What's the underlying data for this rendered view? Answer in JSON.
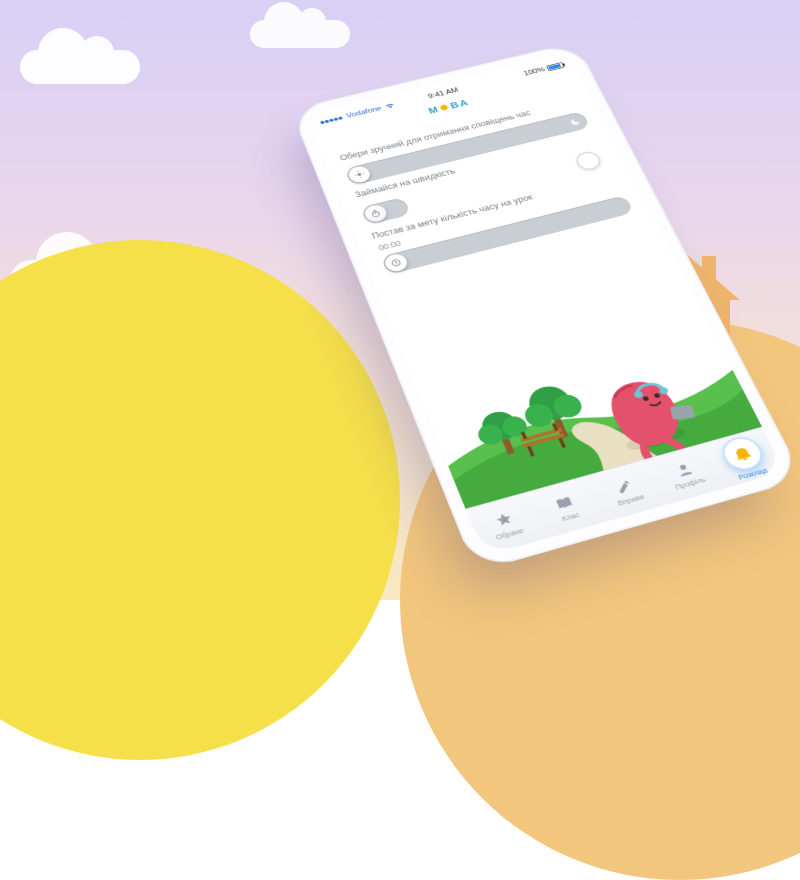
{
  "status": {
    "carrier": "Vodafone",
    "time": "9:41 AM",
    "battery_pct": "100%"
  },
  "brand": {
    "name": "МОВА"
  },
  "sections": {
    "notify_time": {
      "label": "Обери зручний для отримання сповіщень час"
    },
    "speed": {
      "label": "Займайся на швидкість",
      "toggle_on": false
    },
    "goal": {
      "label": "Постав за мету кількість часу на урок",
      "value": "00:00"
    }
  },
  "tabs": {
    "t0": {
      "label": "Обране"
    },
    "t1": {
      "label": "Клас"
    },
    "t2": {
      "label": "Вправи"
    },
    "t3": {
      "label": "Профіль"
    },
    "t4": {
      "label": "Розклад"
    }
  },
  "colors": {
    "accent": "#2e8bf0",
    "track": "#c9cdd4",
    "muted": "#7a7f8a"
  }
}
